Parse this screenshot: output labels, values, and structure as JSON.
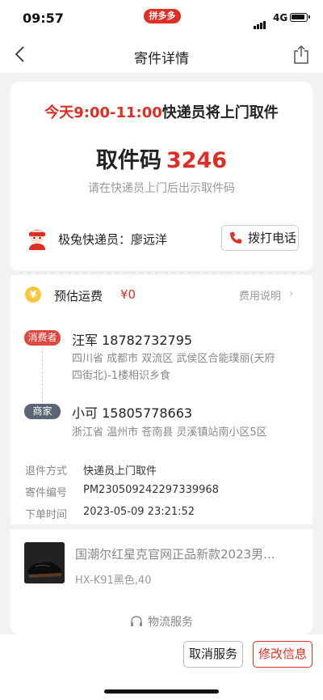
{
  "status_bar": {
    "time": "09:57",
    "app_badge": "拼多多",
    "network": "4G"
  },
  "nav": {
    "title": "寄件详情"
  },
  "pickup": {
    "time_window": "今天9:00-11:00",
    "time_suffix": "快递员将上门取件",
    "code_label": "取件码",
    "code": "3246",
    "hint": "请在快递员上门后出示取件码",
    "courier": "极兔快递员：廖远洋",
    "call_label": "拨打电话"
  },
  "fee": {
    "icon": "¥",
    "label": "预估运费",
    "value": "¥0",
    "link": "费用说明"
  },
  "consumer": {
    "tag": "消费者",
    "name_phone": "汪军 18782732795",
    "address_line1": "四川省 成都市 双流区 武侯区合能璞丽(天府",
    "address_line2": "四街北)-1楼相识乡食"
  },
  "merchant": {
    "tag": "商家",
    "name_phone": "小可 15805778663",
    "address": "浙江省 温州市 苍南县 灵溪镇站南小区5区"
  },
  "info": [
    {
      "label": "退件方式",
      "value": "快递员上门取件"
    },
    {
      "label": "寄件编号",
      "value": "PM230509242297339968"
    },
    {
      "label": "下单时间",
      "value": "2023-05-09 23:21:52"
    }
  ],
  "product": {
    "title": "国潮尔红星克官网正品新款2023男...",
    "sku": "HX-K91黑色,40"
  },
  "logistics_label": "物流服务",
  "buttons": {
    "cancel": "取消服务",
    "modify": "修改信息"
  },
  "colors": {
    "accent_red": "#e02e24",
    "merchant_tag": "#5b6574",
    "consumer_tag": "#e0473f"
  },
  "icons": [
    "back-arrow-icon",
    "share-icon",
    "courier-avatar-icon",
    "phone-icon",
    "yen-coin-icon",
    "chevron-right-icon",
    "headset-icon"
  ]
}
